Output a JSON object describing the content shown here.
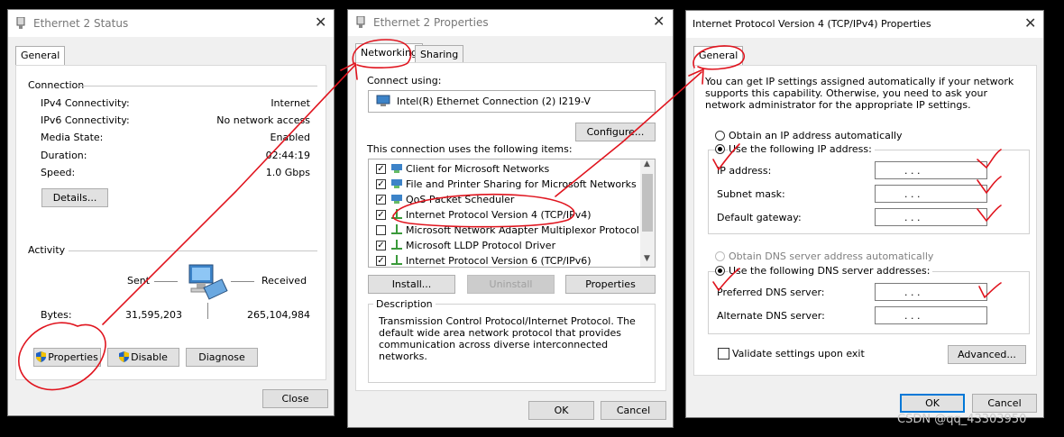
{
  "status_window": {
    "title": "Ethernet 2 Status",
    "tab_general": "General",
    "connection_heading": "Connection",
    "rows": [
      {
        "label": "IPv4 Connectivity:",
        "value": "Internet"
      },
      {
        "label": "IPv6 Connectivity:",
        "value": "No network access"
      },
      {
        "label": "Media State:",
        "value": "Enabled"
      },
      {
        "label": "Duration:",
        "value": "02:44:19"
      },
      {
        "label": "Speed:",
        "value": "1.0 Gbps"
      }
    ],
    "details_button": "Details...",
    "activity_heading": "Activity",
    "sent_label": "Sent",
    "received_label": "Received",
    "bytes_label": "Bytes:",
    "bytes_sent": "31,595,203",
    "bytes_received": "265,104,984",
    "properties_button": "Properties",
    "disable_button": "Disable",
    "diagnose_button": "Diagnose",
    "close_button": "Close"
  },
  "properties_window": {
    "title": "Ethernet 2 Properties",
    "tab_networking": "Networking",
    "tab_sharing": "Sharing",
    "connect_using_label": "Connect using:",
    "adapter_name": "Intel(R) Ethernet Connection (2) I219-V",
    "configure_button": "Configure...",
    "items_label": "This connection uses the following items:",
    "items": [
      {
        "label": "Client for Microsoft Networks",
        "checked": true
      },
      {
        "label": "File and Printer Sharing for Microsoft Networks",
        "checked": true
      },
      {
        "label": "QoS Packet Scheduler",
        "checked": true
      },
      {
        "label": "Internet Protocol Version 4 (TCP/IPv4)",
        "checked": true
      },
      {
        "label": "Microsoft Network Adapter Multiplexor Protocol",
        "checked": false
      },
      {
        "label": "Microsoft LLDP Protocol Driver",
        "checked": true
      },
      {
        "label": "Internet Protocol Version 6 (TCP/IPv6)",
        "checked": true
      }
    ],
    "install_button": "Install...",
    "uninstall_button": "Uninstall",
    "properties_button": "Properties",
    "description_heading": "Description",
    "description_text": "Transmission Control Protocol/Internet Protocol. The default wide area network protocol that provides communication across diverse interconnected networks.",
    "ok_button": "OK",
    "cancel_button": "Cancel"
  },
  "ipv4_window": {
    "title": "Internet Protocol Version 4 (TCP/IPv4) Properties",
    "tab_general": "General",
    "intro_text": "You can get IP settings assigned automatically if your network supports this capability. Otherwise, you need to ask your network administrator for the appropriate IP settings.",
    "obtain_ip_auto": "Obtain an IP address automatically",
    "use_following_ip": "Use the following IP address:",
    "ip_address_label": "IP address:",
    "subnet_mask_label": "Subnet mask:",
    "default_gateway_label": "Default gateway:",
    "obtain_dns_auto": "Obtain DNS server address automatically",
    "use_following_dns": "Use the following DNS server addresses:",
    "preferred_dns_label": "Preferred DNS server:",
    "alternate_dns_label": "Alternate DNS server:",
    "field_dots": ".       .       .",
    "validate_label": "Validate settings upon exit",
    "validate_checked": false,
    "advanced_button": "Advanced...",
    "ok_button": "OK",
    "cancel_button": "Cancel"
  },
  "watermark": "CSDN @qq_43303950",
  "colors": {
    "annotation_red": "#e0141e",
    "focus_blue": "#0078d7"
  }
}
